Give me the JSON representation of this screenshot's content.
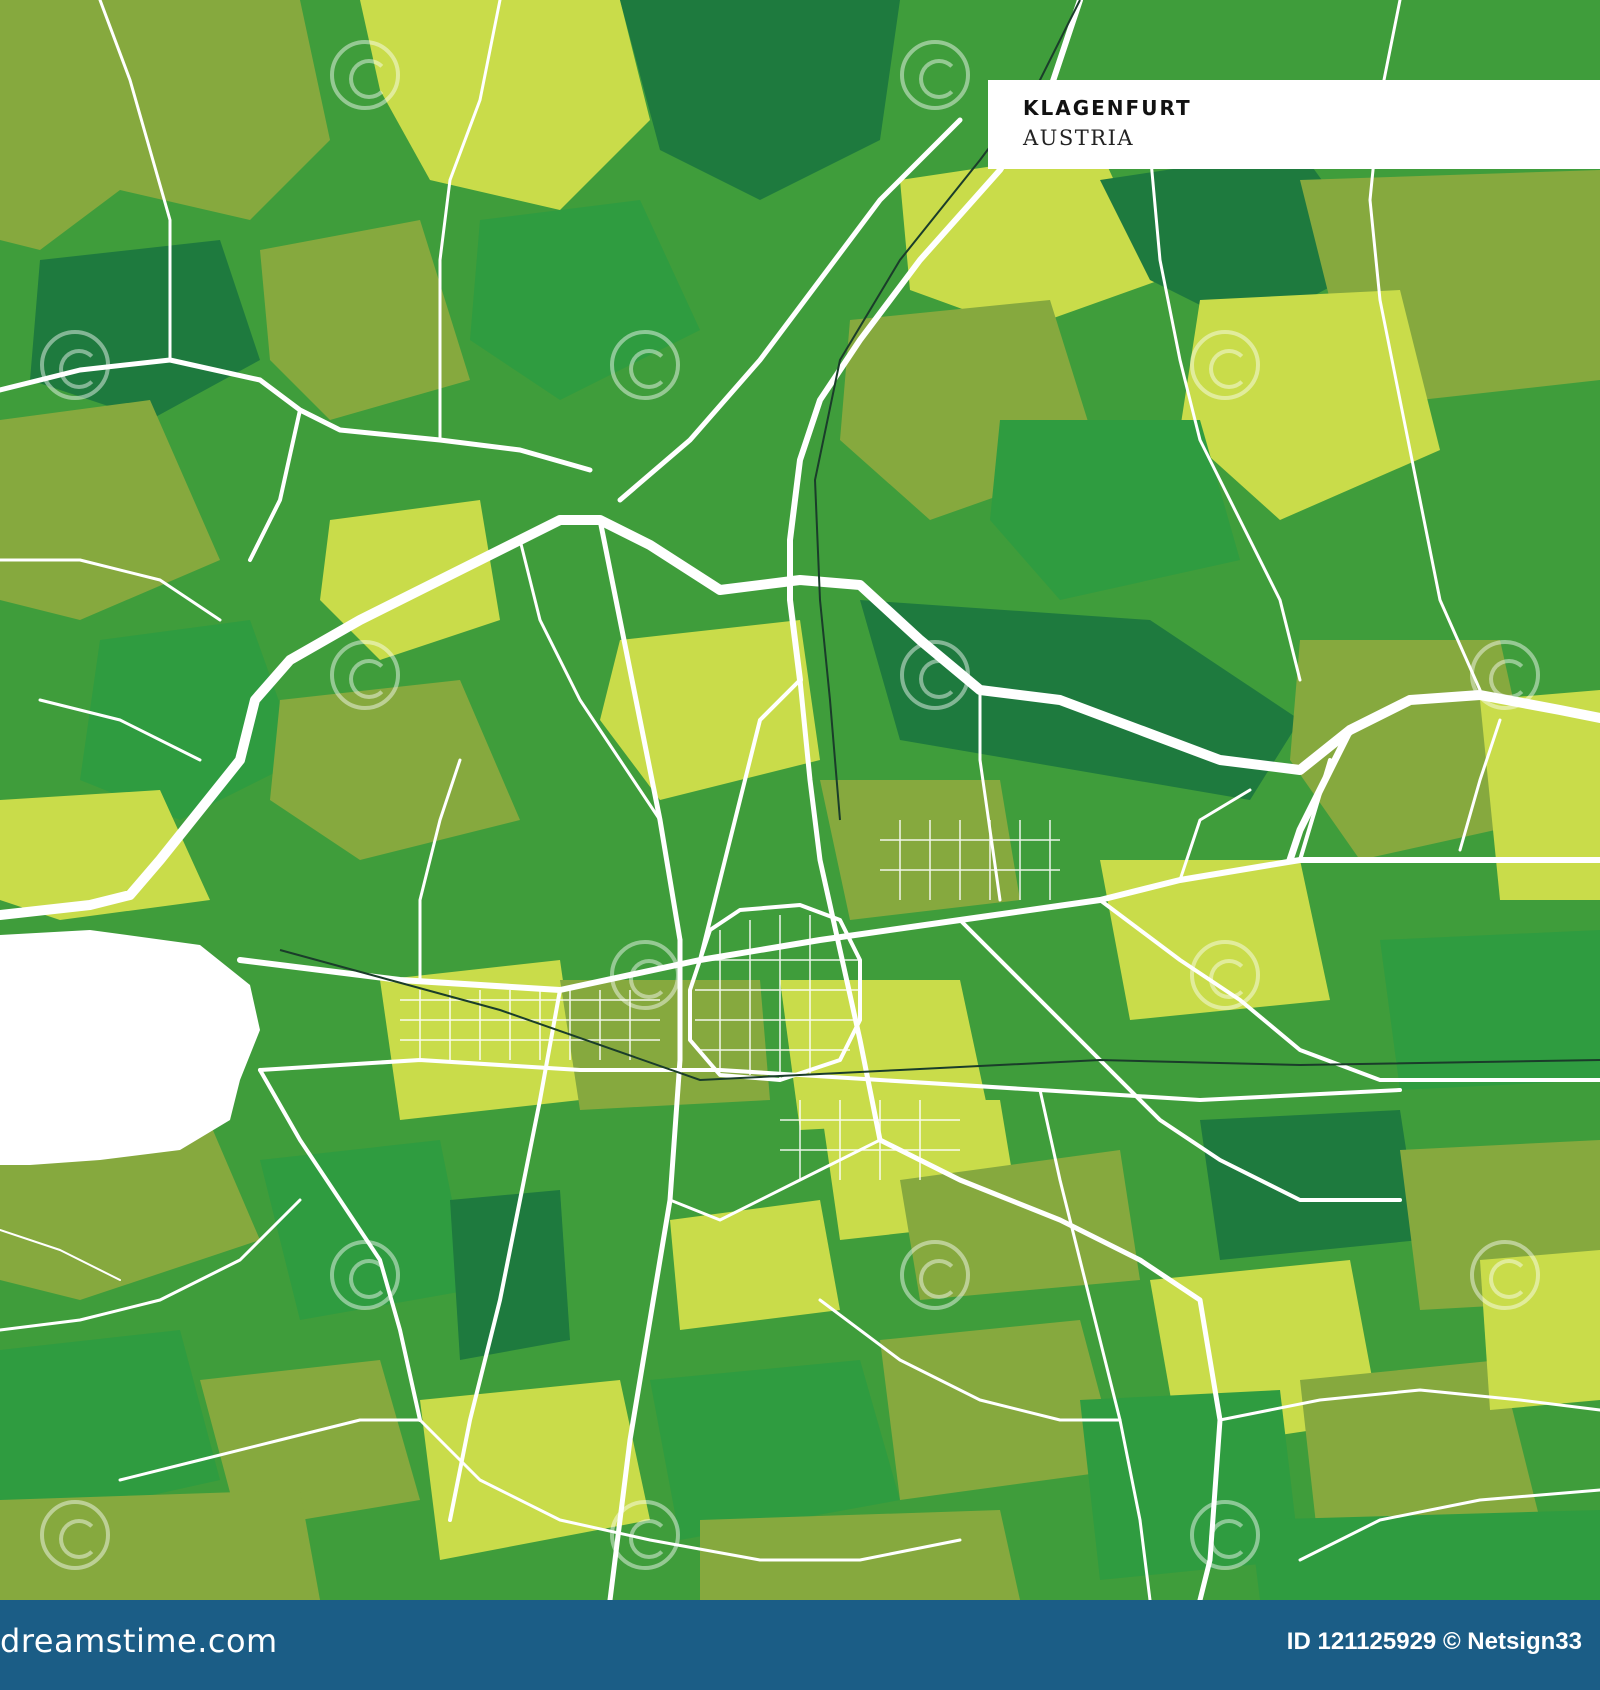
{
  "title": {
    "city": "KLAGENFURT",
    "country": "AUSTRIA"
  },
  "footer": {
    "brand": "dreamstime.com",
    "credit": "ID 121125929 © Netsign33"
  },
  "map": {
    "water_feature": "lake",
    "colors": {
      "background_green": "#3f9d3b",
      "light_green": "#c9dc4a",
      "olive_green": "#86a93e",
      "medium_green": "#2f9c40",
      "dark_green": "#1e7a3e",
      "roads": "#ffffff",
      "water": "#ffffff",
      "footer": "#1b5d86"
    }
  }
}
